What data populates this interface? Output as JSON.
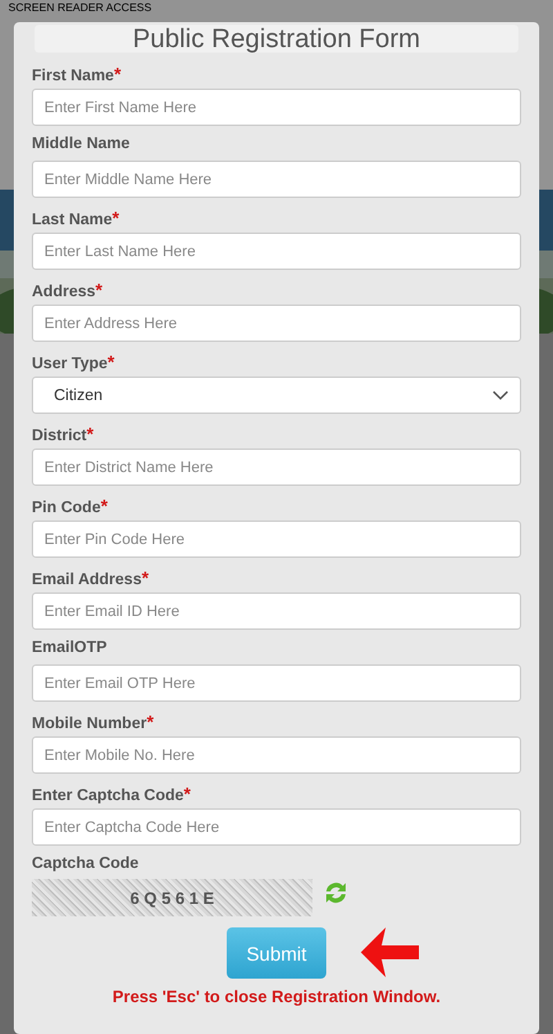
{
  "background": {
    "header_text": "SCREEN READER ACCESS"
  },
  "form": {
    "title": "Public Registration Form",
    "fields": [
      {
        "kind": "text",
        "label": "First Name",
        "mark": "*",
        "placeholder": "Enter First Name Here"
      },
      {
        "kind": "text",
        "label": "Middle Name",
        "placeholder": "Enter Middle Name Here"
      },
      {
        "kind": "text",
        "label": "Last Name",
        "mark": "*",
        "placeholder": "Enter Last Name Here"
      },
      {
        "kind": "text",
        "label": "Address",
        "mark": "*",
        "placeholder": "Enter Address Here"
      },
      {
        "kind": "select",
        "label": "User Type",
        "mark": "*",
        "value": "Citizen"
      },
      {
        "kind": "text",
        "label": "District",
        "mark": "*",
        "placeholder": "Enter District Name Here"
      },
      {
        "kind": "text",
        "label": "Pin Code",
        "mark": "*",
        "placeholder": "Enter Pin Code Here"
      },
      {
        "kind": "text",
        "label": "Email Address",
        "mark": "*",
        "placeholder": "Enter Email ID Here"
      },
      {
        "kind": "text",
        "label": "EmailOTP",
        "placeholder": "Enter Email OTP Here"
      },
      {
        "kind": "text",
        "label": "Mobile Number",
        "mark": "*",
        "placeholder": "Enter Mobile No. Here"
      },
      {
        "kind": "text",
        "label": "Enter Captcha Code",
        "mark": "*",
        "placeholder": "Enter Captcha Code Here"
      }
    ],
    "captcha": {
      "label": "Captcha Code",
      "code": "6 Q 5 6 1 E"
    },
    "submit": "Submit",
    "note": "Press 'Esc' to close Registration Window."
  }
}
